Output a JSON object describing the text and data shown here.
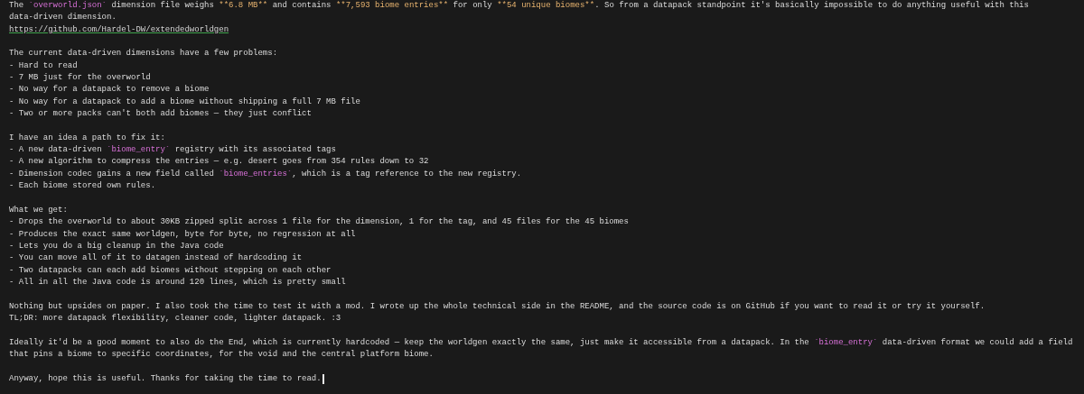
{
  "editor": {
    "cursor_at_end": true,
    "lines": [
      {
        "kind": "text",
        "segments": [
          {
            "kind": "text",
            "text": "The "
          },
          {
            "kind": "code",
            "text": "`overworld.json`"
          },
          {
            "kind": "text",
            "text": " dimension file weighs "
          },
          {
            "kind": "bold",
            "text": "**6.8 MB**"
          },
          {
            "kind": "text",
            "text": " and contains "
          },
          {
            "kind": "bold",
            "text": "**7,593 biome entries**"
          },
          {
            "kind": "text",
            "text": " for only "
          },
          {
            "kind": "bold",
            "text": "**54 unique biomes**"
          },
          {
            "kind": "text",
            "text": ". So from a datapack standpoint it's basically impossible to do anything useful with this"
          }
        ]
      },
      {
        "kind": "text",
        "segments": [
          {
            "kind": "text",
            "text": "data-driven dimension."
          }
        ]
      },
      {
        "kind": "link",
        "text": "https://github.com/Hardel-DW/extendedworldgen"
      },
      {
        "kind": "blank"
      },
      {
        "kind": "text",
        "segments": [
          {
            "kind": "text",
            "text": "The current data-driven dimensions have a few problems:"
          }
        ]
      },
      {
        "kind": "text",
        "segments": [
          {
            "kind": "text",
            "text": "- Hard to read"
          }
        ]
      },
      {
        "kind": "text",
        "segments": [
          {
            "kind": "text",
            "text": "- 7 MB just for the overworld"
          }
        ]
      },
      {
        "kind": "text",
        "segments": [
          {
            "kind": "text",
            "text": "- No way for a datapack to remove a biome"
          }
        ]
      },
      {
        "kind": "text",
        "segments": [
          {
            "kind": "text",
            "text": "- No way for a datapack to add a biome without shipping a full 7 MB file"
          }
        ]
      },
      {
        "kind": "text",
        "segments": [
          {
            "kind": "text",
            "text": "- Two or more packs can't both add biomes — they just conflict"
          }
        ]
      },
      {
        "kind": "blank"
      },
      {
        "kind": "text",
        "segments": [
          {
            "kind": "text",
            "text": "I have an idea a path to fix it:"
          }
        ]
      },
      {
        "kind": "text",
        "segments": [
          {
            "kind": "text",
            "text": "- A new data-driven "
          },
          {
            "kind": "code",
            "text": "`biome_entry`"
          },
          {
            "kind": "text",
            "text": " registry with its associated tags"
          }
        ]
      },
      {
        "kind": "text",
        "segments": [
          {
            "kind": "text",
            "text": "- A new algorithm to compress the entries — e.g. desert goes from 354 rules down to 32"
          }
        ]
      },
      {
        "kind": "text",
        "segments": [
          {
            "kind": "text",
            "text": "- Dimension codec gains a new field called "
          },
          {
            "kind": "code",
            "text": "`biome_entries`"
          },
          {
            "kind": "text",
            "text": ", which is a tag reference to the new registry."
          }
        ]
      },
      {
        "kind": "text",
        "segments": [
          {
            "kind": "text",
            "text": "- Each biome stored own rules."
          }
        ]
      },
      {
        "kind": "blank"
      },
      {
        "kind": "text",
        "segments": [
          {
            "kind": "text",
            "text": "What we get:"
          }
        ]
      },
      {
        "kind": "text",
        "segments": [
          {
            "kind": "text",
            "text": "- Drops the overworld to about 30KB zipped split across 1 file for the dimension, 1 for the tag, and 45 files for the 45 biomes"
          }
        ]
      },
      {
        "kind": "text",
        "segments": [
          {
            "kind": "text",
            "text": "- Produces the exact same worldgen, byte for byte, no regression at all"
          }
        ]
      },
      {
        "kind": "text",
        "segments": [
          {
            "kind": "text",
            "text": "- Lets you do a big cleanup in the Java code"
          }
        ]
      },
      {
        "kind": "text",
        "segments": [
          {
            "kind": "text",
            "text": "- You can move all of it to datagen instead of hardcoding it"
          }
        ]
      },
      {
        "kind": "text",
        "segments": [
          {
            "kind": "text",
            "text": "- Two datapacks can each add biomes without stepping on each other"
          }
        ]
      },
      {
        "kind": "text",
        "segments": [
          {
            "kind": "text",
            "text": "- All in all the Java code is around 120 lines, which is pretty small"
          }
        ]
      },
      {
        "kind": "blank"
      },
      {
        "kind": "text",
        "segments": [
          {
            "kind": "text",
            "text": "Nothing but upsides on paper. I also took the time to test it with a mod. I wrote up the whole technical side in the README, and the source code is on GitHub if you want to read it or try it yourself."
          }
        ]
      },
      {
        "kind": "text",
        "segments": [
          {
            "kind": "text",
            "text": "TL;DR: more datapack flexibility, cleaner code, lighter datapack. :3"
          }
        ]
      },
      {
        "kind": "blank"
      },
      {
        "kind": "text",
        "segments": [
          {
            "kind": "text",
            "text": "Ideally it'd be a good moment to also do the End, which is currently hardcoded — keep the worldgen exactly the same, just make it accessible from a datapack. In the "
          },
          {
            "kind": "code",
            "text": "`biome_entry`"
          },
          {
            "kind": "text",
            "text": " data-driven format we could add a field"
          }
        ]
      },
      {
        "kind": "text",
        "segments": [
          {
            "kind": "text",
            "text": "that pins a biome to specific coordinates, for the void and the central platform biome."
          }
        ]
      },
      {
        "kind": "blank"
      },
      {
        "kind": "text",
        "segments": [
          {
            "kind": "text",
            "text": "Anyway, hope this is useful. Thanks for taking the time to read."
          }
        ]
      }
    ]
  }
}
